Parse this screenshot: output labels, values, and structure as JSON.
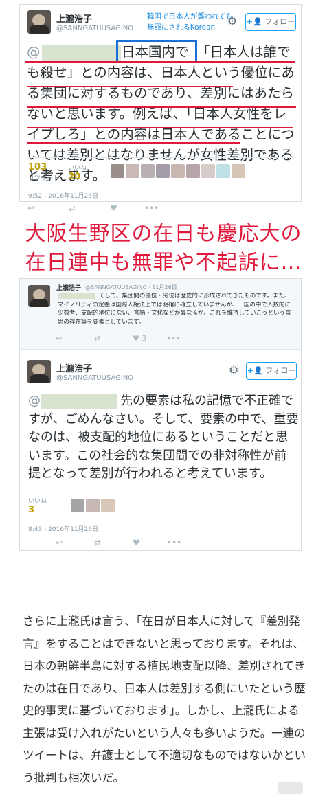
{
  "tweet1": {
    "name": "上瀧浩子",
    "handle": "@SANNGATUUSAGINO",
    "overlay_caption": "韓国で日本人が襲われても無罪にされるKorean",
    "follow_label": "フォロー",
    "mention_prefix": "@",
    "highlight_text": "日本国内で",
    "body": "「日本人は誰でも殺せ」との内容は、日本人という優位にある集団に対するものであり、差別にはあたらないと思います。例えば、「日本人女性をレイプしろ」との内容は日本人であることについては差別とはなりませんが女性差別であると考えます。",
    "retweets_label": "リツイート",
    "retweets": "103",
    "likes_label": "いいね",
    "likes": "20",
    "timestamp": "9:52 - 2016年11月26日"
  },
  "headline": {
    "line1": "大阪生野区の在日も慶応大の",
    "line2": "在日連中も無罪や不起訴に…"
  },
  "tweet2": {
    "name": "上瀧浩子",
    "handle": "@SANNGATUUSAGINO · 11月26日",
    "body": "そして、集団間の優位・劣位は歴史的に形成されてきたものです。また、マイノリティの定義は国際人権法上では明確に確立していませんが、一国の中で人数的に少数者、支配的地位にない、言語・文化などが異なるが、これを維持していこうという意思の存在等を要素としています。"
  },
  "tweet3": {
    "name": "上瀧浩子",
    "handle": "@SANNGATUUSAGINO",
    "follow_label": "フォロー",
    "mention_prefix": "@",
    "body": "先の要素は私の記憶で不正確ですが、ごめんなさい。そして、要素の中で、重要なのは、被支配的地位にあるということだと思います。この社会的な集団間での非対称性が前提となって差別が行われると考えています。",
    "likes_label": "いいね",
    "likes": "3",
    "timestamp": "8:43 - 2016年11月26日"
  },
  "article": {
    "paragraph": "さらに上瀧氏は言う、「在日が日本人に対して『差別発言』をすることはできないと思っております。それは、日本の朝鮮半島に対する植民地支配以降、差別されてきたのは在日であり、日本人は差別する側にいたという歴史的事実に基づいております」。しかし、上瀧氏による主張は受け入れがたいという人々も多いようだ。一連のツイートは、弁護士として不適切なものではないかという批判も相次いだ。"
  },
  "colors": {
    "accent_red": "#e0183b",
    "highlight_blue": "#1a6fd9",
    "twitter_blue": "#1da1f2",
    "like_gold": "#bf9f00"
  },
  "icons": [
    "reply-icon",
    "retweet-icon",
    "heart-icon",
    "more-icon",
    "gear-icon",
    "follow-plus-icon"
  ]
}
